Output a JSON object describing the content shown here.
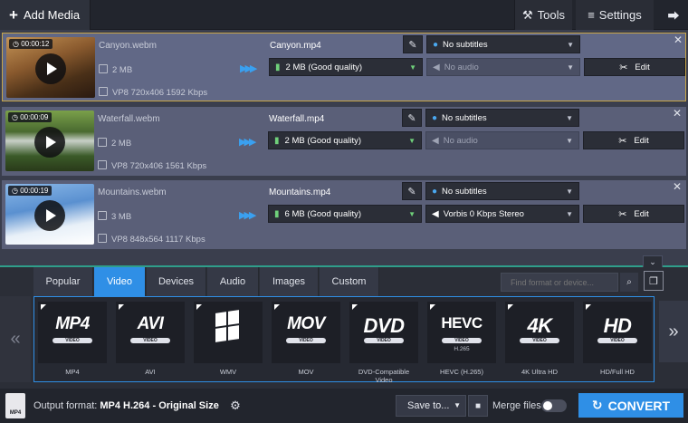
{
  "toolbar": {
    "add_media": "Add Media",
    "tools": "Tools",
    "settings": "Settings"
  },
  "files": [
    {
      "duration": "00:00:12",
      "source_name": "Canyon.webm",
      "source_size": "2 MB",
      "source_codec": "VP8 720x406 1592 Kbps",
      "output_name": "Canyon.mp4",
      "output_quality": "2 MB (Good quality)",
      "subtitles": "No subtitles",
      "audio": "No audio",
      "edit": "Edit",
      "selected": true
    },
    {
      "duration": "00:00:09",
      "source_name": "Waterfall.webm",
      "source_size": "2 MB",
      "source_codec": "VP8 720x406 1561 Kbps",
      "output_name": "Waterfall.mp4",
      "output_quality": "2 MB (Good quality)",
      "subtitles": "No subtitles",
      "audio": "No audio",
      "edit": "Edit",
      "selected": false
    },
    {
      "duration": "00:00:19",
      "source_name": "Mountains.webm",
      "source_size": "3 MB",
      "source_codec": "VP8 848x564 1117 Kbps",
      "output_name": "Mountains.mp4",
      "output_quality": "6 MB (Good quality)",
      "subtitles": "No subtitles",
      "audio": "Vorbis 0 Kbps Stereo",
      "edit": "Edit",
      "selected": false
    }
  ],
  "tabs": [
    "Popular",
    "Video",
    "Devices",
    "Audio",
    "Images",
    "Custom"
  ],
  "active_tab": "Video",
  "search": {
    "placeholder": "Find format or device..."
  },
  "formats": [
    {
      "big": "MP4",
      "pill": "VIDEO",
      "sub": "",
      "label": "MP4"
    },
    {
      "big": "AVI",
      "pill": "VIDEO",
      "sub": "",
      "label": "AVI"
    },
    {
      "big": "",
      "pill": "",
      "sub": "",
      "label": "WMV"
    },
    {
      "big": "MOV",
      "pill": "VIDEO",
      "sub": "",
      "label": "MOV"
    },
    {
      "big": "DVD",
      "pill": "VIDEO",
      "sub": "",
      "label": "DVD-Compatible Video"
    },
    {
      "big": "HEVC",
      "pill": "VIDEO",
      "sub": "H.265",
      "label": "HEVC (H.265)"
    },
    {
      "big": "4K",
      "pill": "VIDEO",
      "sub": "",
      "label": "4K Ultra HD"
    },
    {
      "big": "HD",
      "pill": "VIDEO",
      "sub": "",
      "label": "HD/Full HD"
    }
  ],
  "bottom": {
    "output_prefix": "Output format:",
    "output_format": "MP4 H.264",
    "output_suffix": "- Original Size",
    "save_to": "Save to...",
    "merge_files": "Merge files:",
    "convert": "CONVERT",
    "format_icon_text": "MP4"
  },
  "colors": {
    "accent": "#2f8fe6",
    "selected_border": "#c8a547",
    "arrow": "#3aa0f0",
    "quality_icon": "#6fd07a"
  }
}
